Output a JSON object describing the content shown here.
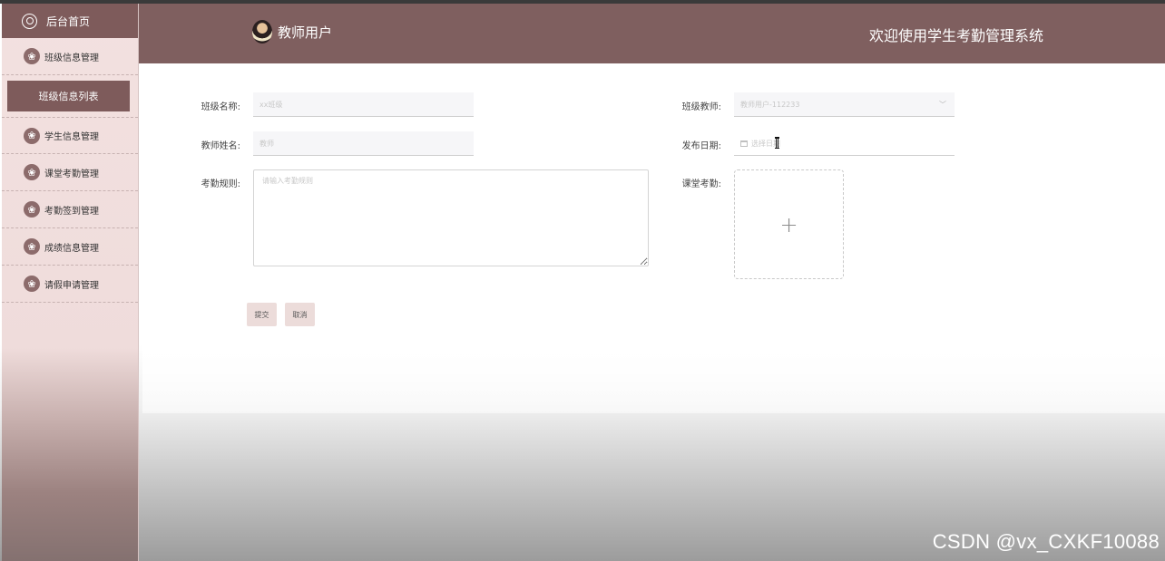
{
  "sidebar": {
    "home_label": "后台首页",
    "menu": [
      {
        "label": "班级信息管理",
        "icon": "flower-icon"
      },
      {
        "label": "学生信息管理",
        "icon": "flower-icon"
      },
      {
        "label": "课堂考勤管理",
        "icon": "flower-icon"
      },
      {
        "label": "考勤签到管理",
        "icon": "flower-icon"
      },
      {
        "label": "成绩信息管理",
        "icon": "flower-icon"
      },
      {
        "label": "请假申请管理",
        "icon": "flower-icon"
      }
    ],
    "submenu_active": "班级信息列表"
  },
  "header": {
    "user_name": "教师用户",
    "system_title": "欢迎使用学生考勤管理系统"
  },
  "form": {
    "class_name_label": "班级名称:",
    "class_name_placeholder": "xx班级",
    "teacher_label": "班级教师:",
    "teacher_value": "教师用户-112233",
    "teacher_name_label": "教师姓名:",
    "teacher_name_placeholder": "教师",
    "publish_date_label": "发布日期:",
    "publish_date_placeholder": "选择日期",
    "rules_label": "考勤规则:",
    "rules_placeholder": "请输入考勤规则",
    "attendance_label": "课堂考勤:",
    "upload_symbol": "+",
    "submit_label": "提交",
    "cancel_label": "取消"
  },
  "watermark": "CSDN @vx_CXKF10088",
  "colors": {
    "primary": "#7e5b5b",
    "sidebar_bg": "#f3e1e0",
    "button_bg": "#ecdcda"
  }
}
